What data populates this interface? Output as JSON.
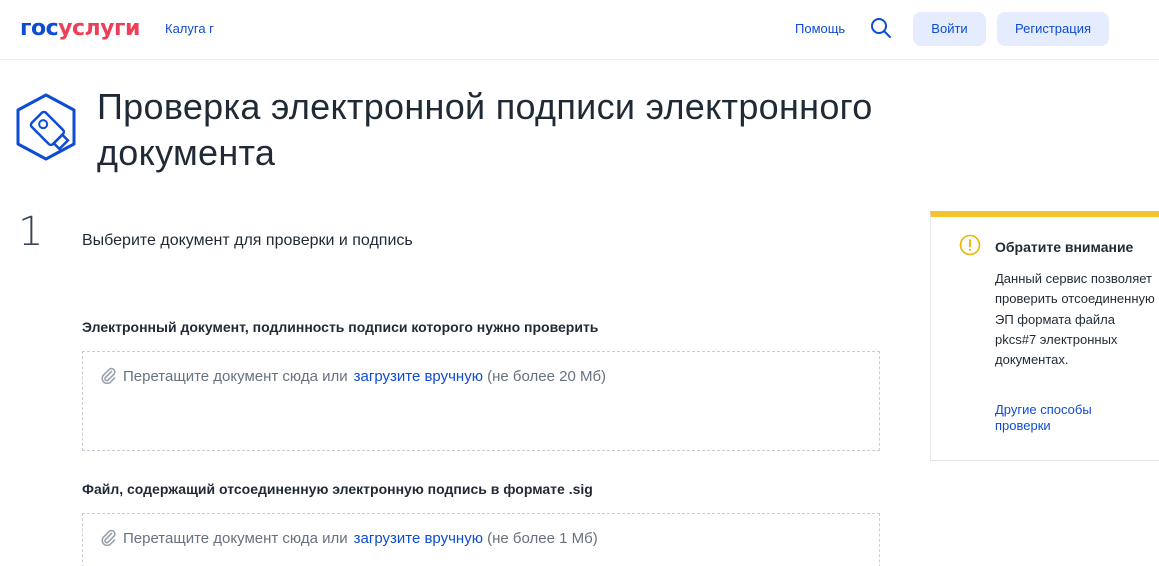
{
  "header": {
    "logo_part1": "гос",
    "logo_part2": "услуги",
    "region": "Калуга г",
    "help": "Помощь",
    "search_icon": "search-icon",
    "login": "Войти",
    "register": "Регистрация"
  },
  "page": {
    "icon": "usb-key-icon",
    "title": "Проверка электронной подписи электронного документа"
  },
  "step": {
    "number": "1",
    "title": "Выберите документ для проверки и подпись"
  },
  "fields": [
    {
      "label": "Электронный документ, подлинность подписи которого нужно проверить",
      "drop_text": "Перетащите документ сюда или",
      "upload_link": "загрузите вручную",
      "limit": "(не более 20 Мб)"
    },
    {
      "label": "Файл, содержащий отсоединенную электронную подпись в формате .sig",
      "drop_text": "Перетащите документ сюда или",
      "upload_link": "загрузите вручную",
      "limit": "(не более 1 Мб)"
    }
  ],
  "notice": {
    "icon": "warning-icon",
    "title": "Обратите внимание",
    "text": "Данный сервис позволяет проверить отсоединенную ЭП формата файла pkcs#7 электронных документах.",
    "link": "Другие способы проверки"
  },
  "colors": {
    "brand_blue": "#0d4cd3",
    "brand_red": "#ee3f58",
    "button_bg": "#e4ecfd",
    "notice_accent": "#f5c42c"
  }
}
